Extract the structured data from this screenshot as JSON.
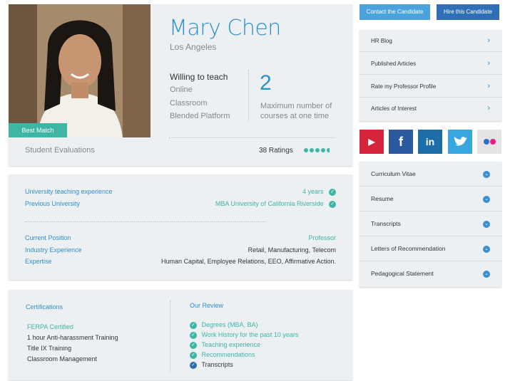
{
  "profile": {
    "name": "Mary Chen",
    "location": "Los Angeles",
    "badge": "Best Match",
    "willing_label": "Willing to teach",
    "modes": [
      "Online",
      "Classroom",
      "Blended Platform"
    ],
    "max_courses": "2",
    "max_courses_label_1": "Maximum number of",
    "max_courses_label_2": "courses at one time",
    "evaluations_label": "Student Evaluations",
    "ratings": "38 Ratings"
  },
  "experience": {
    "rows1": [
      {
        "label": "University teaching experience",
        "value": "4 years"
      },
      {
        "label": "Previous University",
        "value": "MBA University of California Riverside"
      }
    ],
    "rows2": [
      {
        "label": "Current Position",
        "value": "Professor"
      },
      {
        "label": "Industry Experience",
        "value": "Retail, Manufacturing, Telecom"
      },
      {
        "label": "Expertise",
        "value": "Human Capital, Employee Relations, EEO, Affirmative Action."
      }
    ]
  },
  "certifications": {
    "title": "Certifications",
    "items": [
      "FERPA Certified",
      "1 hour Anti-harassment Training",
      "Title IX Training",
      "Classroom Management"
    ]
  },
  "review": {
    "title": "Our Review",
    "items": [
      "Degrees (MBA, BA)",
      "Work History for the past 10 years",
      "Teaching experience",
      "Recommendations",
      "Transcripts"
    ]
  },
  "buttons": {
    "contact": "Contact the Candidate",
    "hire": "Hire this Candidate"
  },
  "links": [
    "HR Blog",
    "Published Articles",
    "Rate my Professor Profile",
    "Articles of Interest"
  ],
  "social": [
    {
      "icon": "youtube-icon",
      "glyph": "▶",
      "color": "#d6243a"
    },
    {
      "icon": "facebook-icon",
      "glyph": "f",
      "color": "#2c5aa0"
    },
    {
      "icon": "linkedin-icon",
      "glyph": "in",
      "color": "#1b6ea8"
    },
    {
      "icon": "twitter-icon",
      "glyph": "🐦",
      "color": "#39a7df"
    },
    {
      "icon": "flickr-icon",
      "glyph": "●●",
      "color": "#e4e4e4"
    }
  ],
  "documents": [
    "Curriculum Vitae",
    "Resume",
    "Transcripts",
    "Letters of Recommendation",
    "Pedagogical Statement"
  ],
  "colors": {
    "accent_blue": "#2f8fc8",
    "accent_teal": "#3fb5a6",
    "dark_blue": "#2f6fa8"
  }
}
